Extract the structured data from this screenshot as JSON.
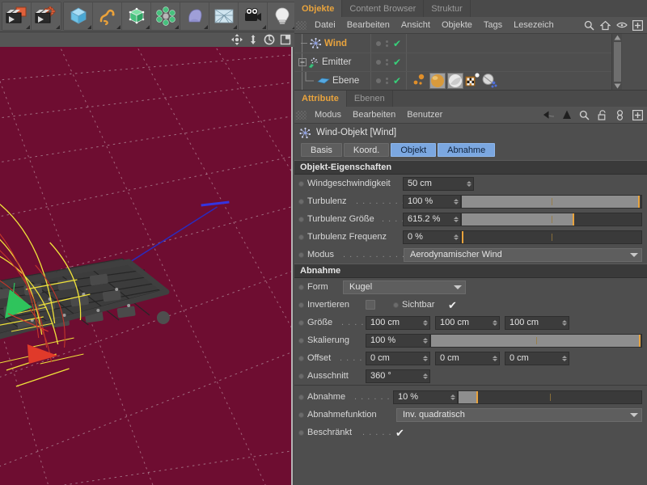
{
  "toolbar": {
    "buttons": [
      {
        "name": "undo-redo-button",
        "icon": "clapboard-orange-icon"
      },
      {
        "name": "render-settings-button",
        "icon": "clapboard-gear-icon"
      },
      {
        "name": "cube-primitive-button",
        "icon": "cube-blue-icon"
      },
      {
        "name": "spline-button",
        "icon": "spline-orange-icon"
      },
      {
        "name": "nurbs-button",
        "icon": "nurbs-green-icon"
      },
      {
        "name": "array-button",
        "icon": "array-green-icon"
      },
      {
        "name": "deformer-button",
        "icon": "bend-deformer-icon"
      },
      {
        "name": "scene-environment-button",
        "icon": "floor-grid-icon"
      },
      {
        "name": "camera-button",
        "icon": "camera-icon"
      },
      {
        "name": "light-button",
        "icon": "lightbulb-icon"
      }
    ]
  },
  "viewport": {
    "nav_icons": [
      {
        "name": "viewport-move-icon",
        "label": "move"
      },
      {
        "name": "viewport-scale-icon",
        "label": "scale"
      },
      {
        "name": "viewport-rotate-icon",
        "label": "rotate"
      },
      {
        "name": "viewport-maximize-icon",
        "label": "maximize"
      }
    ],
    "background_color": "#6e0d31",
    "grid_color": "#b08a99"
  },
  "object_manager": {
    "tabs": [
      {
        "label": "Objekte",
        "active": true
      },
      {
        "label": "Content Browser",
        "active": false
      },
      {
        "label": "Struktur",
        "active": false
      }
    ],
    "menu": [
      "Datei",
      "Bearbeiten",
      "Ansicht",
      "Objekte",
      "Tags",
      "Lesezeich"
    ],
    "menu_icons": [
      "search-icon",
      "home-icon",
      "eye-icon",
      "plus-icon"
    ],
    "rows": [
      {
        "label": "Wind",
        "icon": "wind-object-icon",
        "selected": true,
        "depth": 1,
        "tags": []
      },
      {
        "label": "Emitter",
        "icon": "emitter-object-icon",
        "selected": false,
        "depth": 0,
        "expander": "minus",
        "tags": []
      },
      {
        "label": "Ebene",
        "icon": "plane-object-icon",
        "selected": false,
        "depth": 2,
        "tags": [
          "particle-tag",
          "material-orange-tag",
          "material-white-tag",
          "material-checker-tag",
          "dynamics-tag"
        ]
      }
    ]
  },
  "attribute_manager": {
    "tabs": [
      {
        "label": "Attribute",
        "active": true
      },
      {
        "label": "Ebenen",
        "active": false
      }
    ],
    "menu": [
      "Modus",
      "Bearbeiten",
      "Benutzer"
    ],
    "menu_icons": [
      "back-arrow-icon",
      "forward-arrow-icon",
      "up-arrow-icon",
      "search-icon",
      "lock-icon",
      "link-icon",
      "plus-icon"
    ],
    "object_title": "Wind-Objekt [Wind]",
    "object_icon": "wind-object-icon",
    "mode_tabs": [
      {
        "label": "Basis",
        "selected": false
      },
      {
        "label": "Koord.",
        "selected": false
      },
      {
        "label": "Objekt",
        "selected": true
      },
      {
        "label": "Abnahme",
        "selected": false
      }
    ]
  },
  "object_properties": {
    "section_title": "Objekt-Eigenschaften",
    "rows": [
      {
        "name": "windgeschwindigkeit",
        "label": "Windgeschwindigkeit",
        "leader": "",
        "value": "50 cm",
        "type": "number"
      },
      {
        "name": "turbulenz",
        "label": "Turbulenz",
        "leader": ". . . . . . . . .",
        "value": "100 %",
        "type": "slider",
        "fill_pct": 99,
        "mark_pct": 99,
        "mid_pct": 50
      },
      {
        "name": "turbulenz-groesse",
        "label": "Turbulenz Größe",
        "leader": ". . . .",
        "value": "615.2 %",
        "type": "slider",
        "fill_pct": 62,
        "mark_pct": 62,
        "mid_pct": 50
      },
      {
        "name": "turbulenz-frequenz",
        "label": "Turbulenz Frequenz",
        "leader": "",
        "value": "0 %",
        "type": "slider",
        "fill_pct": 0,
        "mark_pct": 0,
        "mid_pct": 50
      },
      {
        "name": "modus",
        "label": "Modus",
        "leader": ". . . . . . . . . . . .",
        "value": "Aerodynamischer Wind",
        "type": "dropdown"
      }
    ]
  },
  "falloff": {
    "section_title": "Abnahme",
    "form": {
      "label": "Form",
      "value": "Kugel"
    },
    "invertieren": {
      "label": "Invertieren",
      "checked": false
    },
    "sichtbar": {
      "label": "Sichtbar",
      "checked": true
    },
    "groesse": {
      "label": "Größe",
      "leader": ". . . .",
      "values": [
        "100 cm",
        "100 cm",
        "100 cm"
      ]
    },
    "skalierung": {
      "label": "Skalierung",
      "value": "100 %",
      "fill_pct": 99,
      "mark_pct": 99,
      "mid_pct": 50
    },
    "offset": {
      "label": "Offset",
      "leader": ". . . .",
      "values": [
        "0 cm",
        "0 cm",
        "0 cm"
      ]
    },
    "ausschnitt": {
      "label": "Ausschnitt",
      "value": "360 °"
    }
  },
  "falloff_curve": {
    "abnahme": {
      "label": "Abnahme",
      "leader": ". . . . . . .",
      "value": "10 %",
      "fill_pct": 10,
      "mark_pct": 10,
      "mid_pct": 50
    },
    "abnahmefunktion": {
      "label": "Abnahmefunktion",
      "value": "Inv. quadratisch"
    },
    "beschraenkt": {
      "label": "Beschränkt",
      "leader": ". . . . . .",
      "checked": true
    }
  },
  "colors": {
    "accent_orange": "#e8a33d",
    "tab_selected_blue": "#7ba7e0",
    "check_green": "#37d17a",
    "panel_bg": "#4e4e4e",
    "section_bg": "#3a3a3a"
  }
}
